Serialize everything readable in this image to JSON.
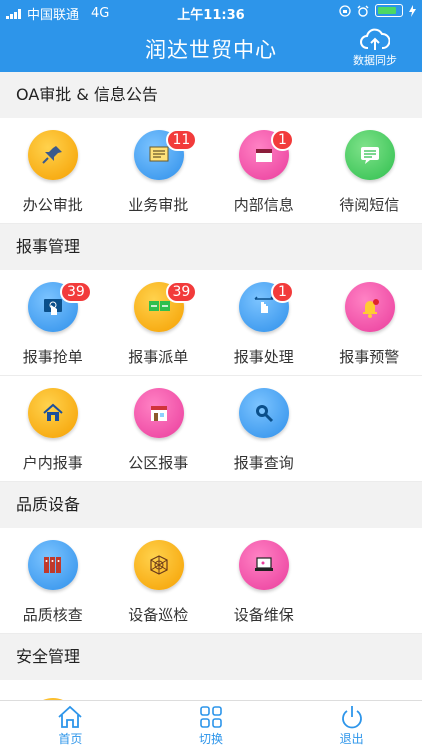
{
  "status_bar": {
    "carrier": "中国联通",
    "network": "4G",
    "time": "上午11:36"
  },
  "header": {
    "title": "润达世贸中心",
    "sync_label": "数据同步"
  },
  "sections": [
    {
      "title": "OA审批 & 信息公告",
      "rows": [
        [
          {
            "label": "办公审批",
            "icon": "pushpin-icon",
            "color": "orange",
            "badge": ""
          },
          {
            "label": "业务审批",
            "icon": "document-list-icon",
            "color": "blue",
            "badge": "11"
          },
          {
            "label": "内部信息",
            "icon": "folder-icon",
            "color": "pink",
            "badge": "1"
          },
          {
            "label": "待阅短信",
            "icon": "message-icon",
            "color": "green",
            "badge": ""
          }
        ]
      ]
    },
    {
      "title": "报事管理",
      "rows": [
        [
          {
            "label": "报事抢单",
            "icon": "touch-screen-icon",
            "color": "blue",
            "badge": "39"
          },
          {
            "label": "报事派单",
            "icon": "dispatch-icon",
            "color": "orange",
            "badge": "39"
          },
          {
            "label": "报事处理",
            "icon": "swipe-hand-icon",
            "color": "blue",
            "badge": "1"
          },
          {
            "label": "报事预警",
            "icon": "bell-icon",
            "color": "pink",
            "badge": ""
          }
        ],
        [
          {
            "label": "户内报事",
            "icon": "house-icon",
            "color": "orange",
            "badge": ""
          },
          {
            "label": "公区报事",
            "icon": "storefront-icon",
            "color": "pink",
            "badge": ""
          },
          {
            "label": "报事查询",
            "icon": "magnifier-icon",
            "color": "blue",
            "badge": ""
          }
        ]
      ]
    },
    {
      "title": "品质设备",
      "rows": [
        [
          {
            "label": "品质核查",
            "icon": "binders-icon",
            "color": "blue",
            "badge": ""
          },
          {
            "label": "设备巡检",
            "icon": "web-icon",
            "color": "orange",
            "badge": ""
          },
          {
            "label": "设备维保",
            "icon": "laptop-icon",
            "color": "pink",
            "badge": ""
          }
        ]
      ]
    },
    {
      "title": "安全管理"
    }
  ],
  "tabbar": [
    {
      "label": "首页",
      "icon": "home-icon"
    },
    {
      "label": "切换",
      "icon": "grid-icon"
    },
    {
      "label": "退出",
      "icon": "power-icon"
    }
  ]
}
